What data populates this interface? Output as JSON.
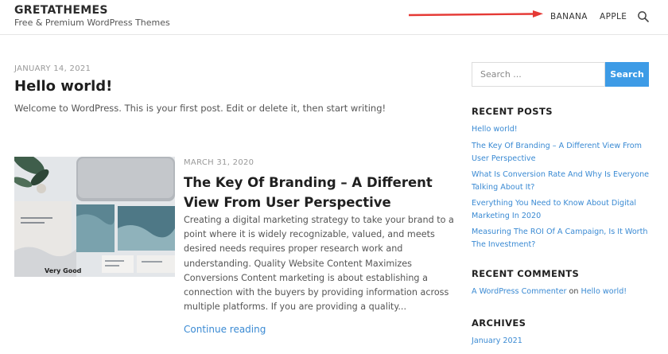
{
  "site": {
    "title": "GRETATHEMES",
    "description": "Free & Premium WordPress Themes"
  },
  "nav": {
    "items": [
      "BANANA",
      "APPLE"
    ],
    "search_icon": "search-icon",
    "annotation_arrow_color": "#e53935"
  },
  "posts": [
    {
      "date": "JANUARY 14, 2021",
      "title": "Hello world!",
      "excerpt": "Welcome to WordPress. This is your first post. Edit or delete it, then start writing!"
    },
    {
      "date": "MARCH 31, 2020",
      "title": "The Key Of Branding – A Different View From User Perspective",
      "excerpt": "Creating a digital marketing strategy to take your brand to a point where it is widely recognizable, valued, and meets desired needs requires proper research work and understanding. Quality Website Content Maximizes Conversions Content marketing is about establishing a connection with the buyers by providing information across multiple platforms. If you are providing a quality...",
      "thumbnail_caption": "Very Good",
      "continue_label": "Continue reading"
    }
  ],
  "sidebar": {
    "search_placeholder": "Search ...",
    "search_button": "Search",
    "recent_posts_title": "RECENT POSTS",
    "recent_posts": [
      "Hello world!",
      "The Key Of Branding – A Different View From User Perspective",
      "What Is Conversion Rate And Why Is Everyone Talking About It?",
      "Everything You Need to Know About Digital Marketing In 2020",
      "Measuring The ROI Of A Campaign, Is It Worth The Investment?"
    ],
    "recent_comments_title": "RECENT COMMENTS",
    "recent_comment": {
      "author": "A WordPress Commenter",
      "connector": "on",
      "post": "Hello world!"
    },
    "archives_title": "ARCHIVES",
    "archives": [
      "January 2021"
    ]
  },
  "colors": {
    "accent": "#3d9be6",
    "link": "#3a8ad3"
  }
}
